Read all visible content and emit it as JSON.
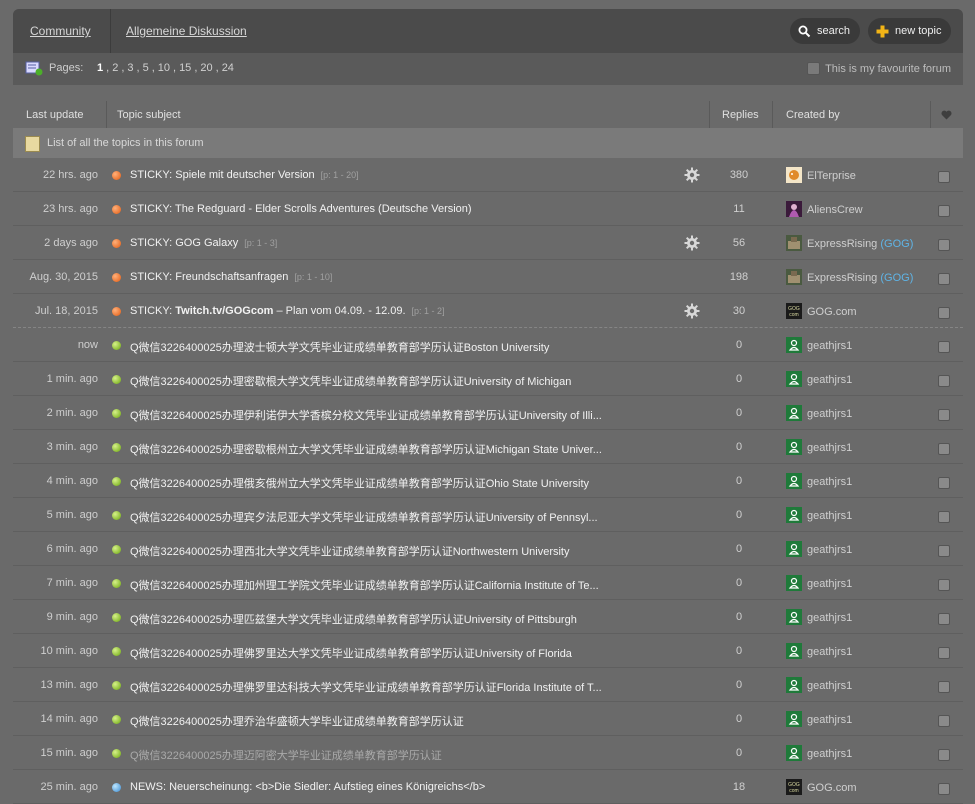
{
  "breadcrumb": {
    "community": "Community",
    "forum": "Allgemeine Diskussion"
  },
  "buttons": {
    "search": "search",
    "new_topic": "new topic"
  },
  "pagination": {
    "label": "Pages:",
    "pages": [
      "1",
      "2",
      "3",
      "5",
      "10",
      "15",
      "20",
      "24"
    ],
    "current": "1"
  },
  "favourite": {
    "label": "This is my favourite forum"
  },
  "columns": {
    "last_update": "Last update",
    "subject": "Topic subject",
    "replies": "Replies",
    "created_by": "Created by"
  },
  "info": "List of all the topics in this forum",
  "topics": [
    {
      "time": "22 hrs. ago",
      "dot": "orange",
      "prefix": "STICKY: Spiele mit deutscher Version",
      "bold": "",
      "suffix": "",
      "pages": "[p: 1 - 20]",
      "gear": true,
      "replies": "380",
      "avatar": "elt",
      "creator": "ElTerprise",
      "gog": "",
      "sticky_last": false,
      "dim": false
    },
    {
      "time": "23 hrs. ago",
      "dot": "orange",
      "prefix": "STICKY: The Redguard - Elder Scrolls Adventures (Deutsche Version)",
      "bold": "",
      "suffix": "",
      "pages": "",
      "gear": false,
      "replies": "11",
      "avatar": "alien",
      "creator": "AliensCrew",
      "gog": "",
      "sticky_last": false,
      "dim": false
    },
    {
      "time": "2 days ago",
      "dot": "orange",
      "prefix": "STICKY: GOG Galaxy",
      "bold": "",
      "suffix": "",
      "pages": "[p: 1 - 3]",
      "gear": true,
      "replies": "56",
      "avatar": "express",
      "creator": "ExpressRising",
      "gog": "(GOG)",
      "sticky_last": false,
      "dim": false
    },
    {
      "time": "Aug. 30, 2015",
      "dot": "orange",
      "prefix": "STICKY: Freundschaftsanfragen",
      "bold": "",
      "suffix": "",
      "pages": "[p: 1 - 10]",
      "gear": false,
      "replies": "198",
      "avatar": "express",
      "creator": "ExpressRising",
      "gog": "(GOG)",
      "sticky_last": false,
      "dim": false
    },
    {
      "time": "Jul. 18, 2015",
      "dot": "orange",
      "prefix": "STICKY: ",
      "bold": "Twitch.tv/GOGcom",
      "suffix": " – Plan vom 04.09. - 12.09.",
      "pages": "[p: 1 - 2]",
      "gear": true,
      "replies": "30",
      "avatar": "gog",
      "creator": "GOG.com",
      "gog": "",
      "sticky_last": true,
      "dim": false
    },
    {
      "time": "now",
      "dot": "green",
      "prefix": "Q微信3226400025办理波士顿大学文凭毕业证成绩单教育部学历认证Boston University",
      "bold": "",
      "suffix": "",
      "pages": "",
      "gear": false,
      "replies": "0",
      "avatar": "user",
      "creator": "geathjrs1",
      "gog": "",
      "sticky_last": false,
      "dim": false
    },
    {
      "time": "1 min. ago",
      "dot": "green",
      "prefix": "Q微信3226400025办理密歇根大学文凭毕业证成绩单教育部学历认证University of Michigan",
      "bold": "",
      "suffix": "",
      "pages": "",
      "gear": false,
      "replies": "0",
      "avatar": "user",
      "creator": "geathjrs1",
      "gog": "",
      "sticky_last": false,
      "dim": false
    },
    {
      "time": "2 min. ago",
      "dot": "green",
      "prefix": "Q微信3226400025办理伊利诺伊大学香槟分校文凭毕业证成绩单教育部学历认证University of Illi...",
      "bold": "",
      "suffix": "",
      "pages": "",
      "gear": false,
      "replies": "0",
      "avatar": "user",
      "creator": "geathjrs1",
      "gog": "",
      "sticky_last": false,
      "dim": false
    },
    {
      "time": "3 min. ago",
      "dot": "green",
      "prefix": "Q微信3226400025办理密歇根州立大学文凭毕业证成绩单教育部学历认证Michigan State Univer...",
      "bold": "",
      "suffix": "",
      "pages": "",
      "gear": false,
      "replies": "0",
      "avatar": "user",
      "creator": "geathjrs1",
      "gog": "",
      "sticky_last": false,
      "dim": false
    },
    {
      "time": "4 min. ago",
      "dot": "green",
      "prefix": "Q微信3226400025办理俄亥俄州立大学文凭毕业证成绩单教育部学历认证Ohio State University",
      "bold": "",
      "suffix": "",
      "pages": "",
      "gear": false,
      "replies": "0",
      "avatar": "user",
      "creator": "geathjrs1",
      "gog": "",
      "sticky_last": false,
      "dim": false
    },
    {
      "time": "5 min. ago",
      "dot": "green",
      "prefix": "Q微信3226400025办理宾夕法尼亚大学文凭毕业证成绩单教育部学历认证University of Pennsyl...",
      "bold": "",
      "suffix": "",
      "pages": "",
      "gear": false,
      "replies": "0",
      "avatar": "user",
      "creator": "geathjrs1",
      "gog": "",
      "sticky_last": false,
      "dim": false
    },
    {
      "time": "6 min. ago",
      "dot": "green",
      "prefix": "Q微信3226400025办理西北大学文凭毕业证成绩单教育部学历认证Northwestern University",
      "bold": "",
      "suffix": "",
      "pages": "",
      "gear": false,
      "replies": "0",
      "avatar": "user",
      "creator": "geathjrs1",
      "gog": "",
      "sticky_last": false,
      "dim": false
    },
    {
      "time": "7 min. ago",
      "dot": "green",
      "prefix": "Q微信3226400025办理加州理工学院文凭毕业证成绩单教育部学历认证California Institute of Te...",
      "bold": "",
      "suffix": "",
      "pages": "",
      "gear": false,
      "replies": "0",
      "avatar": "user",
      "creator": "geathjrs1",
      "gog": "",
      "sticky_last": false,
      "dim": false
    },
    {
      "time": "9 min. ago",
      "dot": "green",
      "prefix": "Q微信3226400025办理匹兹堡大学文凭毕业证成绩单教育部学历认证University of Pittsburgh",
      "bold": "",
      "suffix": "",
      "pages": "",
      "gear": false,
      "replies": "0",
      "avatar": "user",
      "creator": "geathjrs1",
      "gog": "",
      "sticky_last": false,
      "dim": false
    },
    {
      "time": "10 min. ago",
      "dot": "green",
      "prefix": "Q微信3226400025办理佛罗里达大学文凭毕业证成绩单教育部学历认证University of Florida",
      "bold": "",
      "suffix": "",
      "pages": "",
      "gear": false,
      "replies": "0",
      "avatar": "user",
      "creator": "geathjrs1",
      "gog": "",
      "sticky_last": false,
      "dim": false
    },
    {
      "time": "13 min. ago",
      "dot": "green",
      "prefix": "Q微信3226400025办理佛罗里达科技大学文凭毕业证成绩单教育部学历认证Florida Institute of T...",
      "bold": "",
      "suffix": "",
      "pages": "",
      "gear": false,
      "replies": "0",
      "avatar": "user",
      "creator": "geathjrs1",
      "gog": "",
      "sticky_last": false,
      "dim": false
    },
    {
      "time": "14 min. ago",
      "dot": "green",
      "prefix": "Q微信3226400025办理乔治华盛顿大学毕业证成绩单教育部学历认证",
      "bold": "",
      "suffix": "",
      "pages": "",
      "gear": false,
      "replies": "0",
      "avatar": "user",
      "creator": "geathjrs1",
      "gog": "",
      "sticky_last": false,
      "dim": false
    },
    {
      "time": "15 min. ago",
      "dot": "green",
      "prefix": "Q微信3226400025办理迈阿密大学毕业证成绩单教育部学历认证",
      "bold": "",
      "suffix": "",
      "pages": "",
      "gear": false,
      "replies": "0",
      "avatar": "user",
      "creator": "geathjrs1",
      "gog": "",
      "sticky_last": false,
      "dim": true
    },
    {
      "time": "25 min. ago",
      "dot": "blue",
      "prefix": "NEWS: Neuerscheinung: <b>Die Siedler: Aufstieg eines Königreichs</b>",
      "bold": "",
      "suffix": "",
      "pages": "",
      "gear": false,
      "replies": "18",
      "avatar": "gog",
      "creator": "GOG.com",
      "gog": "",
      "sticky_last": false,
      "dim": false
    }
  ]
}
